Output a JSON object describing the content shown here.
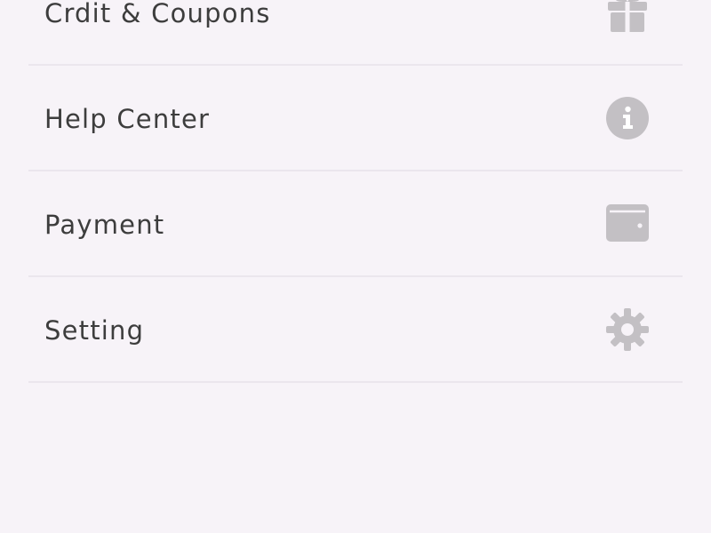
{
  "menu": {
    "items": [
      {
        "label": "Crdit & Coupons",
        "icon": "gift-icon"
      },
      {
        "label": "Help Center",
        "icon": "info-icon"
      },
      {
        "label": "Payment",
        "icon": "wallet-icon"
      },
      {
        "label": "Setting",
        "icon": "gear-icon"
      }
    ]
  },
  "colors": {
    "background": "#f7f3f8",
    "divider": "#ebe6ed",
    "text": "#3d3d3d",
    "icon": "#c3c0c4"
  }
}
